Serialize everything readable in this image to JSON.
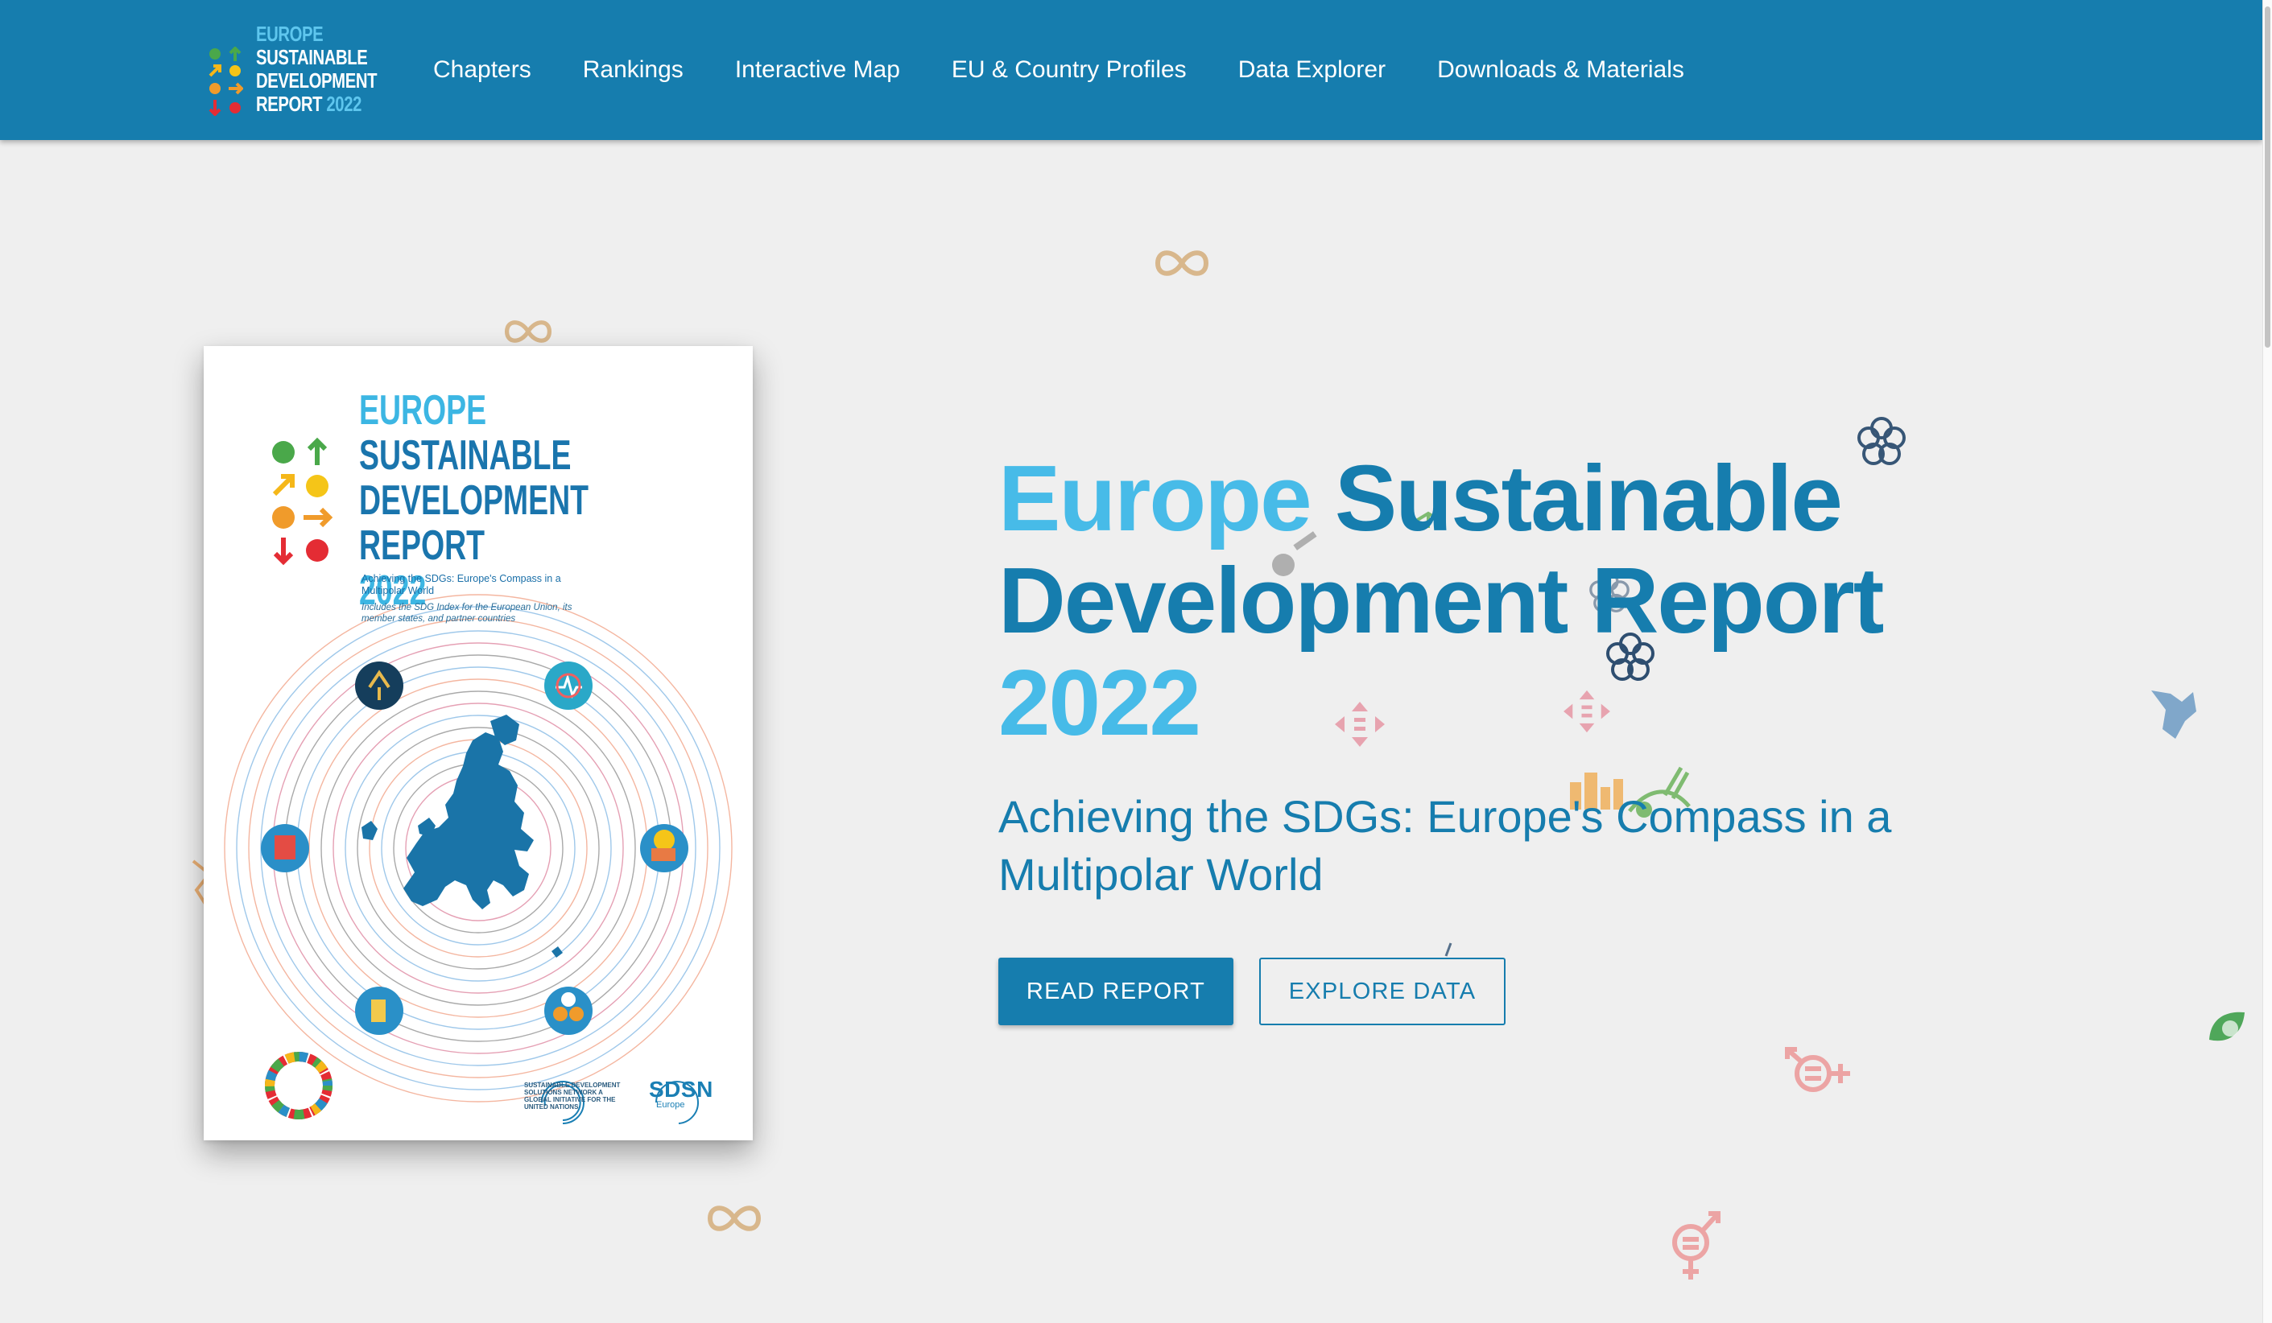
{
  "logo": {
    "line1": "EUROPE",
    "line2": "SUSTAINABLE",
    "line3": "DEVELOPMENT",
    "line4_a": "REPORT",
    "line4_b": "2022"
  },
  "nav": {
    "items": [
      {
        "label": "Chapters"
      },
      {
        "label": "Rankings"
      },
      {
        "label": "Interactive Map"
      },
      {
        "label": "EU & Country Profiles"
      },
      {
        "label": "Data Explorer"
      },
      {
        "label": "Downloads & Materials"
      }
    ]
  },
  "cover": {
    "title_line1": "EUROPE",
    "title_line2": "SUSTAINABLE",
    "title_line3": "DEVELOPMENT",
    "title_line4_a": "REPORT",
    "title_line4_b": "2022",
    "subtitle": "Achieving the SDGs: Europe's Compass in a Multipolar World",
    "note": "Includes the SDG Index for the European Union, its member states, and partner countries",
    "org_text": "SUSTAINABLE DEVELOPMENT SOLUTIONS NETWORK A GLOBAL INITIATIVE FOR THE UNITED NATIONS",
    "sdsn": "SDSN",
    "sdsn_region": "Europe"
  },
  "hero": {
    "title_part1": "Europe",
    "title_part2": " Sustainable Development Report",
    "title_part3": "2022",
    "subtitle": "Achieving the SDGs: Europe's Compass in a Multipolar World"
  },
  "buttons": {
    "read": "READ REPORT",
    "explore": "EXPLORE DATA"
  },
  "colors": {
    "nav_background": "#167dae",
    "title_dark": "#167dae",
    "title_light": "#47bbe8",
    "page_background": "#efefef"
  },
  "icons": [
    "infinity-icon",
    "flower-icon",
    "gender-equality-icon",
    "sdg-wheel-icon",
    "europe-map-icon",
    "arrow-up-icon",
    "arrow-right-icon",
    "arrow-down-icon"
  ]
}
